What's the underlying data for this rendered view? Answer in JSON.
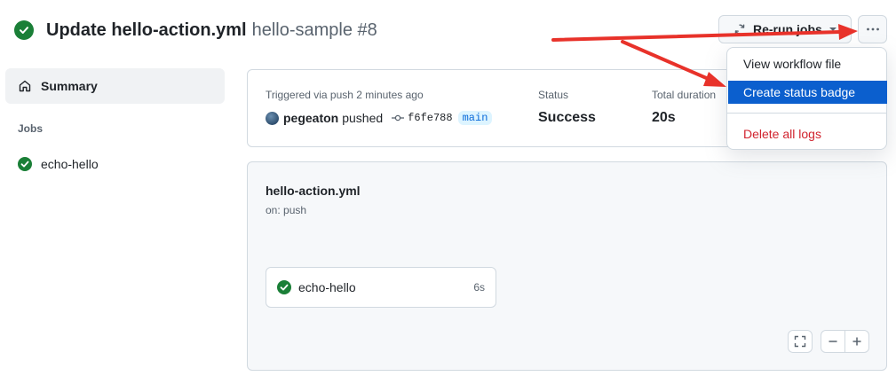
{
  "header": {
    "title": "Update hello-action.yml",
    "subtitle": "hello-sample #8"
  },
  "toolbar": {
    "rerun_label": "Re-run jobs",
    "more_icon": "kebab-horizontal-icon"
  },
  "sidebar": {
    "summary_label": "Summary",
    "jobs_heading": "Jobs",
    "jobs": [
      {
        "label": "echo-hello",
        "status": "success"
      }
    ]
  },
  "summary": {
    "trigger_text": "Triggered via push 2 minutes ago",
    "actor": "pegeaton",
    "action": "pushed",
    "commit": "f6fe788",
    "branch": "main",
    "status_label": "Status",
    "status_value": "Success",
    "duration_label": "Total duration",
    "duration_value": "20s"
  },
  "graph": {
    "workflow_name": "hello-action.yml",
    "trigger": "on: push",
    "job_name": "echo-hello",
    "job_duration": "6s"
  },
  "menu": {
    "items": [
      {
        "label": "View workflow file"
      },
      {
        "label": "Create status badge"
      },
      {
        "label": "Delete all logs"
      }
    ]
  },
  "colors": {
    "success": "#1a7f37",
    "menu_highlight": "#0b5fce",
    "danger": "#d1242f",
    "annotation_arrow": "#e8322a",
    "branch_bg": "#ddf4ff"
  }
}
